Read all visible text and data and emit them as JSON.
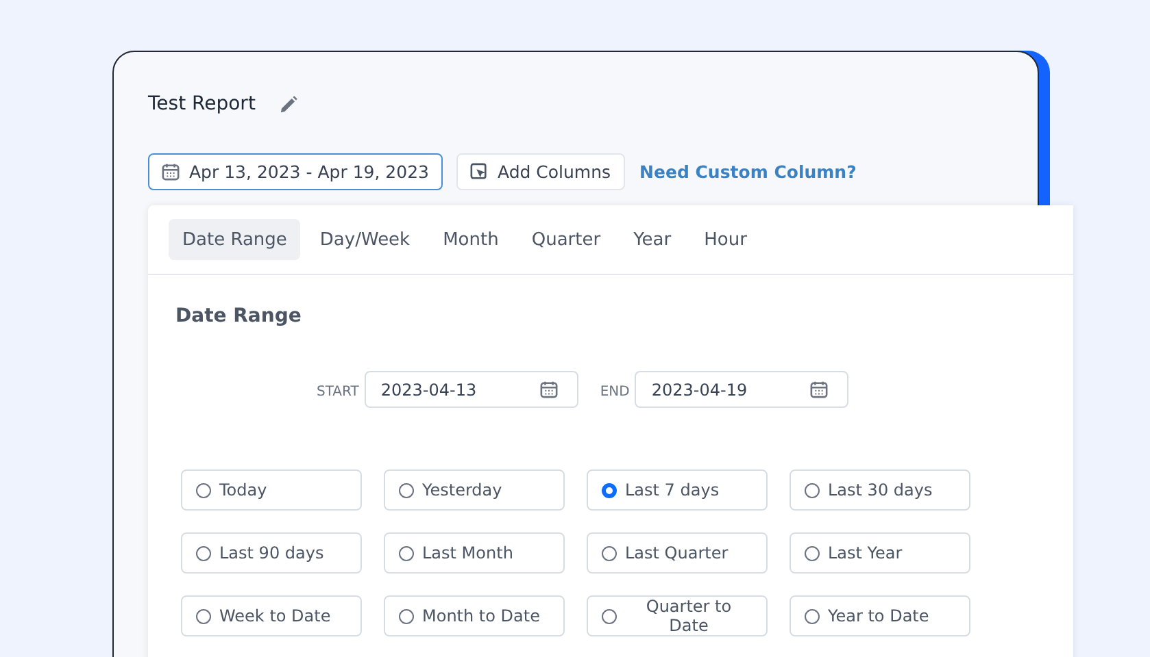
{
  "report": {
    "title": "Test Report"
  },
  "toolbar": {
    "date_range": "Apr 13, 2023 - Apr 19, 2023",
    "add_columns": "Add Columns",
    "custom_link": "Need Custom Column?"
  },
  "tabs": [
    {
      "label": "Date Range",
      "selected": true
    },
    {
      "label": "Day/Week",
      "selected": false
    },
    {
      "label": "Month",
      "selected": false
    },
    {
      "label": "Quarter",
      "selected": false
    },
    {
      "label": "Year",
      "selected": false
    },
    {
      "label": "Hour",
      "selected": false
    }
  ],
  "section_title": "Date Range",
  "start": {
    "label": "START",
    "value": "2023-04-13"
  },
  "end": {
    "label": "END",
    "value": "2023-04-19"
  },
  "presets": [
    {
      "label": "Today",
      "selected": false
    },
    {
      "label": "Yesterday",
      "selected": false
    },
    {
      "label": "Last 7 days",
      "selected": true
    },
    {
      "label": "Last 30 days",
      "selected": false
    },
    {
      "label": "Last 90 days",
      "selected": false
    },
    {
      "label": "Last Month",
      "selected": false
    },
    {
      "label": "Last Quarter",
      "selected": false
    },
    {
      "label": "Last Year",
      "selected": false
    },
    {
      "label": "Week to Date",
      "selected": false
    },
    {
      "label": "Month to Date",
      "selected": false
    },
    {
      "label": "Quarter to Date",
      "selected": false
    },
    {
      "label": "Year to Date",
      "selected": false
    }
  ]
}
